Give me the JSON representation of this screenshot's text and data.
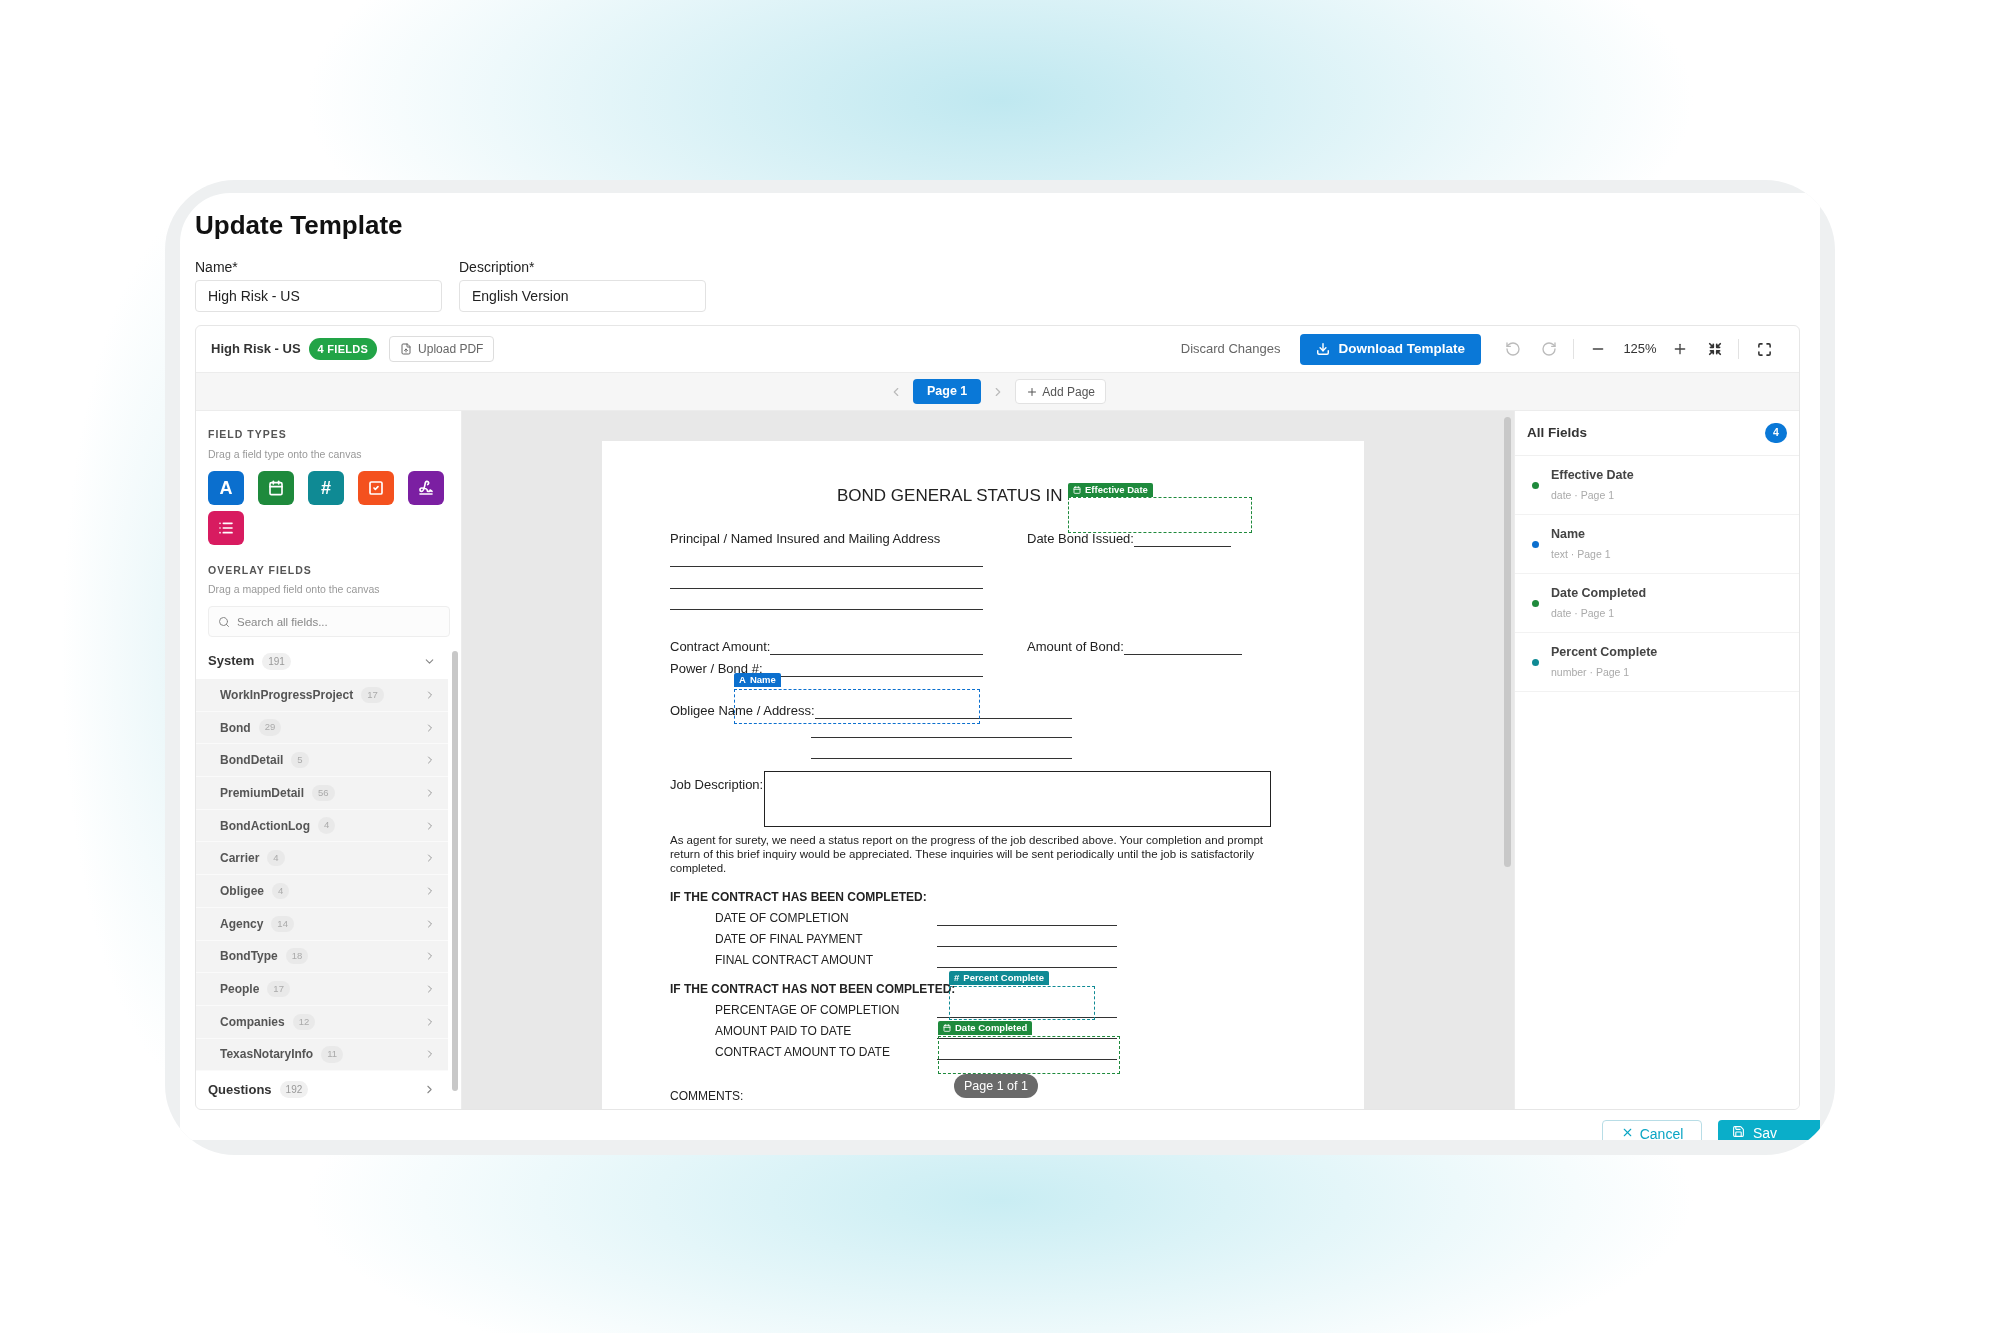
{
  "title": "Update Template",
  "form": [
    {
      "label": "Name*",
      "value": "High Risk - US"
    },
    {
      "label": "Description*",
      "value": "English Version"
    }
  ],
  "toolbar": {
    "template_name": "High Risk - US",
    "field_count": "4 FIELDS",
    "upload": "Upload PDF",
    "discard": "Discard Changes",
    "download": "Download Template",
    "zoom": "125%"
  },
  "pages": {
    "tabs": [
      {
        "label": "Page 1",
        "selected": true
      }
    ],
    "add": "Add Page"
  },
  "field_types": {
    "title": "FIELD TYPES",
    "hint": "Drag a field type onto the canvas",
    "types": [
      {
        "kind": "text",
        "glyph": "A",
        "color": "#0b6fce"
      },
      {
        "kind": "date",
        "color": "#1e8a3c"
      },
      {
        "kind": "number",
        "glyph": "#",
        "color": "#0f8a94"
      },
      {
        "kind": "checkbox",
        "color": "#f4511e"
      },
      {
        "kind": "signature",
        "color": "#7b1fa2"
      },
      {
        "kind": "list",
        "color": "#d81b60"
      }
    ]
  },
  "overlay_fields": {
    "title": "OVERLAY FIELDS",
    "hint": "Drag a mapped field onto the canvas",
    "search_placeholder": "Search all fields...",
    "groups": [
      {
        "name": "System",
        "count": "191",
        "expanded": true,
        "children": [
          {
            "name": "WorkInProgressProject",
            "count": "17"
          },
          {
            "name": "Bond",
            "count": "29"
          },
          {
            "name": "BondDetail",
            "count": "5"
          },
          {
            "name": "PremiumDetail",
            "count": "56"
          },
          {
            "name": "BondActionLog",
            "count": "4"
          },
          {
            "name": "Carrier",
            "count": "4"
          },
          {
            "name": "Obligee",
            "count": "4"
          },
          {
            "name": "Agency",
            "count": "14"
          },
          {
            "name": "BondType",
            "count": "18"
          },
          {
            "name": "People",
            "count": "17"
          },
          {
            "name": "Companies",
            "count": "12"
          },
          {
            "name": "TexasNotaryInfo",
            "count": "11"
          }
        ]
      },
      {
        "name": "Questions",
        "count": "192",
        "expanded": false
      }
    ]
  },
  "document": {
    "title": "BOND GENERAL STATUS IN",
    "principal": "Principal / Named Insured and Mailing Address",
    "date_issued": "Date Bond Issued:",
    "contract_amount": "Contract Amount:",
    "bond_amount": "Amount of Bond:",
    "power": "Power / Bond #:",
    "obligee": "Obligee Name / Address:",
    "job": "Job Description:",
    "paragraph": "As agent for surety, we need a status report on the progress of the job described above. Your completion and prompt return of this brief inquiry would be appreciated. These inquiries will be sent periodically until the job is satisfactorily completed.",
    "sections": [
      {
        "heading": "IF THE CONTRACT HAS BEEN COMPLETED:",
        "items": [
          "DATE OF COMPLETION",
          "DATE OF FINAL PAYMENT",
          "FINAL CONTRACT AMOUNT"
        ]
      },
      {
        "heading": "IF THE CONTRACT HAS NOT BEEN COMPLETED:",
        "items": [
          "PERCENTAGE OF COMPLETION",
          "AMOUNT PAID TO DATE",
          "CONTRACT AMOUNT TO DATE"
        ]
      }
    ],
    "comments": "COMMENTS:"
  },
  "placed_fields": [
    {
      "label": "Effective Date",
      "kind": "date",
      "color": "#1e8a3c"
    },
    {
      "label": "Name",
      "kind": "text",
      "glyph": "A",
      "color": "#0b6fce"
    },
    {
      "label": "Percent Complete",
      "kind": "number",
      "glyph": "#",
      "color": "#0f8a94"
    },
    {
      "label": "Date Completed",
      "kind": "date",
      "color": "#1e8a3c"
    }
  ],
  "page_indicator": "Page 1 of 1",
  "all_fields": {
    "title": "All Fields",
    "count": "4",
    "items": [
      {
        "name": "Effective Date",
        "meta": "date · Page 1",
        "color": "#1e8a3c"
      },
      {
        "name": "Name",
        "meta": "text · Page 1",
        "color": "#0b6fce"
      },
      {
        "name": "Date Completed",
        "meta": "date · Page 1",
        "color": "#1e8a3c"
      },
      {
        "name": "Percent Complete",
        "meta": "number · Page 1",
        "color": "#0f8a94"
      }
    ]
  },
  "footer": {
    "cancel": "Cancel",
    "save": "Sav"
  }
}
